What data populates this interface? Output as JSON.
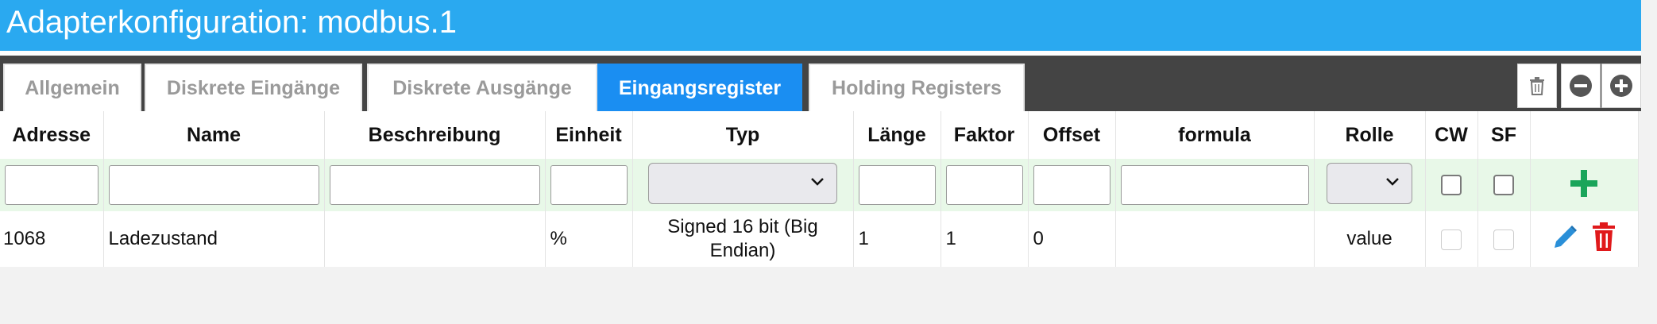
{
  "window": {
    "title": "Adapterkonfiguration: modbus.1"
  },
  "tabs": [
    {
      "label": "Allgemein",
      "active": false
    },
    {
      "label": "Diskrete Eingänge",
      "active": false
    },
    {
      "label": "Diskrete Ausgänge",
      "active": false
    },
    {
      "label": "Eingangsregister",
      "active": true
    },
    {
      "label": "Holding Registers",
      "active": false
    }
  ],
  "toolbar": {
    "icons": [
      "trash-icon",
      "minus-circle-icon",
      "plus-circle-icon"
    ]
  },
  "table": {
    "columns": [
      "Adresse",
      "Name",
      "Beschreibung",
      "Einheit",
      "Typ",
      "Länge",
      "Faktor",
      "Offset",
      "formula",
      "Rolle",
      "CW",
      "SF"
    ],
    "filter": {
      "adresse": "",
      "name": "",
      "beschreibung": "",
      "einheit": "",
      "typ": "",
      "laenge": "",
      "faktor": "",
      "offset": "",
      "formula": "",
      "rolle": ""
    },
    "rows": [
      {
        "adresse": "1068",
        "name": "Ladezustand",
        "beschreibung": "",
        "einheit": "%",
        "typ": "Signed 16 bit (Big Endian)",
        "laenge": "1",
        "faktor": "1",
        "offset": "0",
        "formula": "",
        "rolle": "value",
        "cw": false,
        "sf": false
      }
    ]
  },
  "colors": {
    "title_bar": "#2aa9f0",
    "active_tab": "#1a8ef2",
    "tab_bar": "#444444",
    "filter_row": "#e8f8e8",
    "add_icon": "#1aa55a",
    "edit_icon": "#2a8fd8",
    "delete_icon": "#e0191b"
  }
}
